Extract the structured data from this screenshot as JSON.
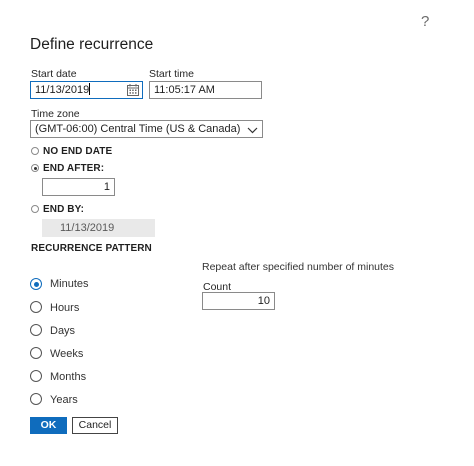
{
  "dialog": {
    "help_glyph": "?",
    "title": "Define recurrence"
  },
  "start": {
    "date_label": "Start date",
    "date_value": "11/13/2019",
    "time_label": "Start time",
    "time_value": "11:05:17 AM"
  },
  "timezone": {
    "label": "Time zone",
    "selected": "(GMT-06:00) Central Time (US & Canada)"
  },
  "end": {
    "no_end_date_label": "NO END DATE",
    "end_after_label": "END AFTER:",
    "end_after_value": "1",
    "end_by_label": "END BY:",
    "end_by_value": "11/13/2019",
    "selected": "END AFTER:"
  },
  "pattern": {
    "heading": "RECURRENCE PATTERN",
    "options": [
      "Minutes",
      "Hours",
      "Days",
      "Weeks",
      "Months",
      "Years"
    ],
    "selected": "Minutes",
    "description": "Repeat after specified number of minutes",
    "count_label": "Count",
    "count_value": "10"
  },
  "buttons": {
    "ok_label": "OK",
    "cancel_label": "Cancel"
  },
  "colors": {
    "accent": "#0f6cbd",
    "disabled_field": "#e9e9e9"
  },
  "icons": [
    "help-icon",
    "calendar-icon",
    "chevron-down-icon"
  ]
}
